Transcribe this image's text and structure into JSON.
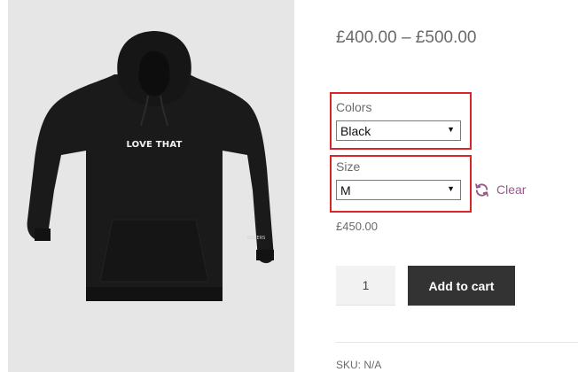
{
  "product": {
    "image": {
      "front_print": "LOVE THAT",
      "sleeve_print": "SISTERS"
    },
    "price_range": "£400.00 – £500.00",
    "attributes": {
      "colors": {
        "label": "Colors",
        "selected": "Black"
      },
      "size": {
        "label": "Size",
        "selected": "M"
      },
      "clear_label": "Clear"
    },
    "variation_price": "£450.00",
    "quantity": "1",
    "add_to_cart_label": "Add to cart",
    "sku_label": "SKU:",
    "sku_value": "N/A"
  },
  "colors": {
    "highlight_border": "#d9252a",
    "link": "#96588a",
    "button_bg": "#333333",
    "image_bg": "#e6e6e6"
  },
  "icons": {
    "refresh": "refresh-icon",
    "dropdown": "caret-down-icon"
  }
}
